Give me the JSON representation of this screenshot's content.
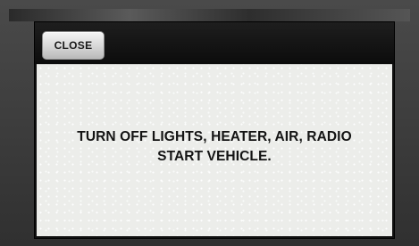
{
  "dialog": {
    "close_label": "CLOSE",
    "message_lines": [
      "TURN OFF LIGHTS, HEATER, AIR, RADIO",
      "START VEHICLE."
    ]
  }
}
